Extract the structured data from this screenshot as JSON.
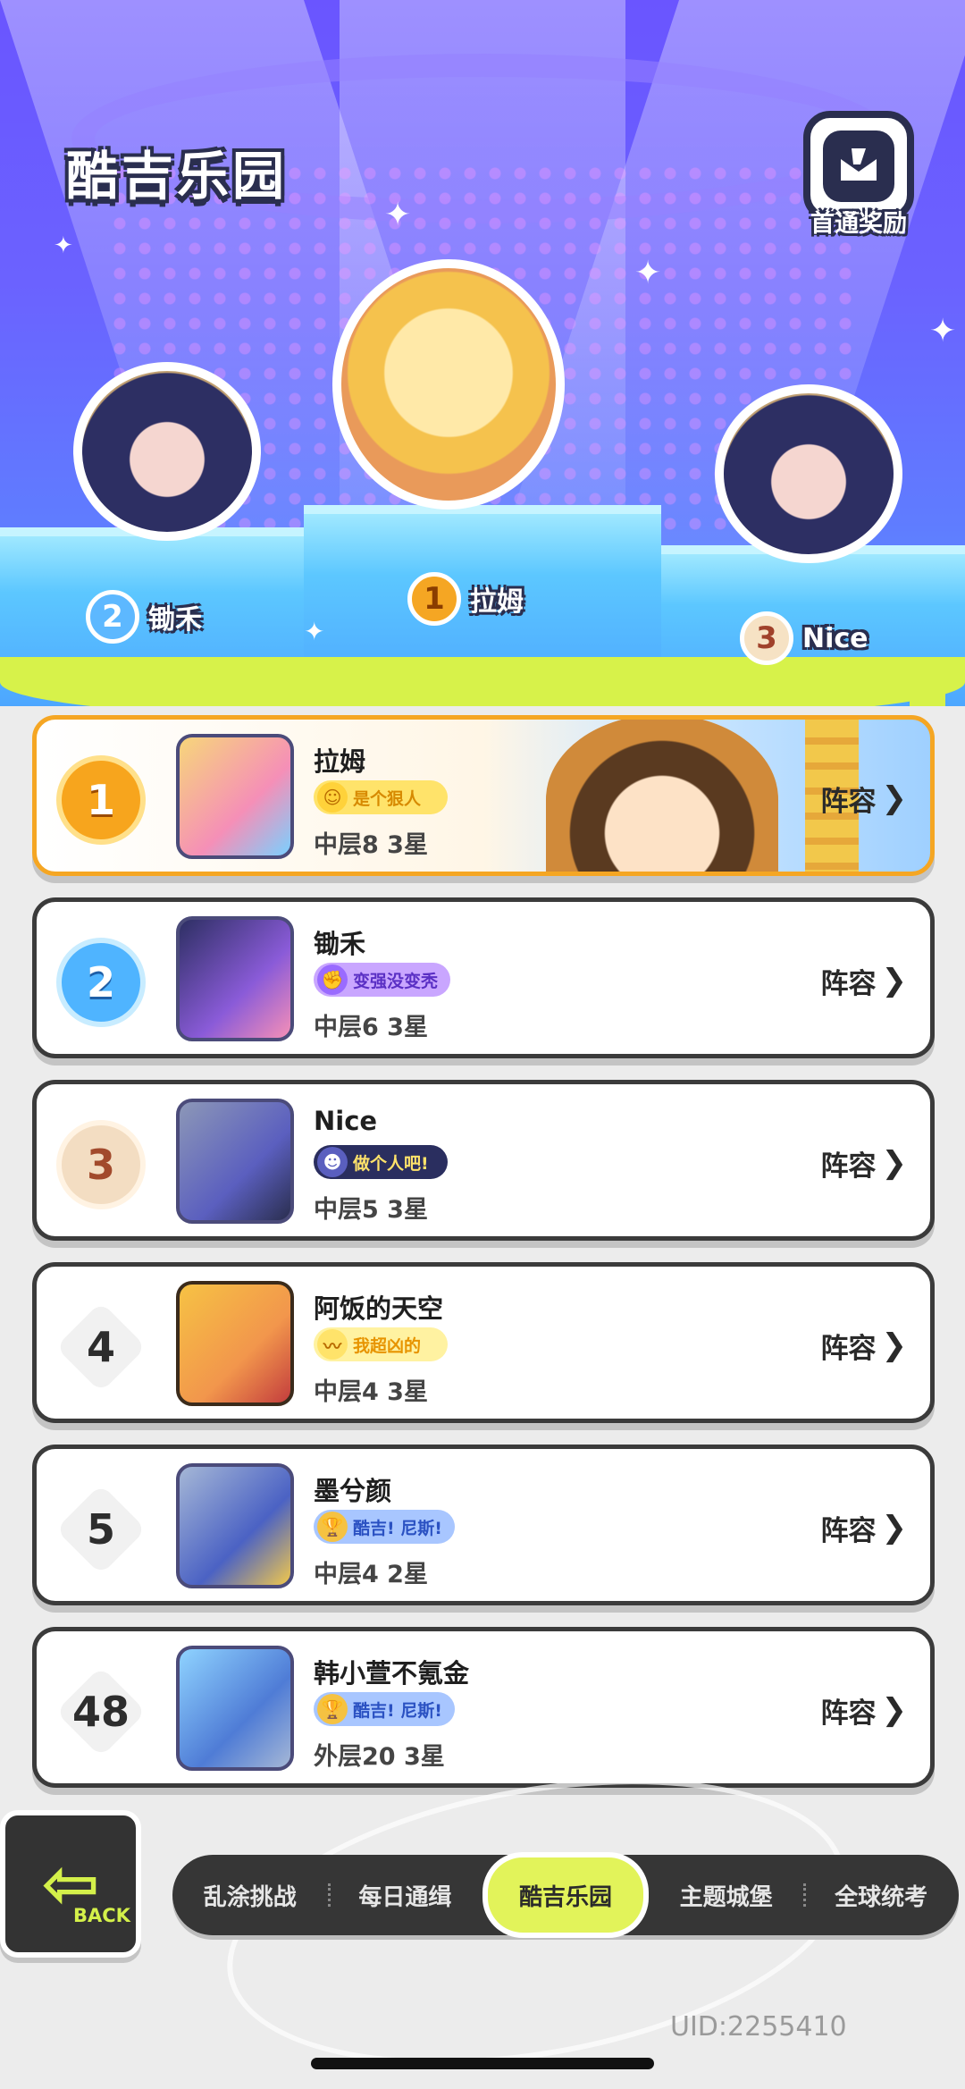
{
  "header": {
    "title": "酷吉乐园",
    "reward_label": "首通奖励"
  },
  "podium": [
    {
      "rank": "2",
      "name": "锄禾"
    },
    {
      "rank": "1",
      "name": "拉姆"
    },
    {
      "rank": "3",
      "name": "Nice"
    }
  ],
  "rankings": [
    {
      "rank": "1",
      "name": "拉姆",
      "tag": "是个狠人",
      "stage": "中层8 3星",
      "button": "阵容"
    },
    {
      "rank": "2",
      "name": "锄禾",
      "tag": "变强没变秃",
      "stage": "中层6 3星",
      "button": "阵容"
    },
    {
      "rank": "3",
      "name": "Nice",
      "tag": "做个人吧!",
      "stage": "中层5 3星",
      "button": "阵容"
    },
    {
      "rank": "4",
      "name": "阿饭的天空",
      "tag": "我超凶的",
      "stage": "中层4 3星",
      "button": "阵容"
    },
    {
      "rank": "5",
      "name": "墨兮颜",
      "tag": "酷吉! 尼斯!",
      "stage": "中层4 2星",
      "button": "阵容"
    },
    {
      "rank": "48",
      "name": "韩小萱不氪金",
      "tag": "酷吉! 尼斯!",
      "stage": "外层20 3星",
      "button": "阵容"
    }
  ],
  "back": {
    "label": "BACK"
  },
  "tabs": [
    "乱涂挑战",
    "每日通缉",
    "酷吉乐园",
    "主题城堡",
    "全球统考"
  ],
  "active_tab": "酷吉乐园",
  "uid": "UID:2255410",
  "colors": {
    "accent": "#e2f35a",
    "gold": "#f5a623",
    "hero_bg": "#6a55ff"
  }
}
